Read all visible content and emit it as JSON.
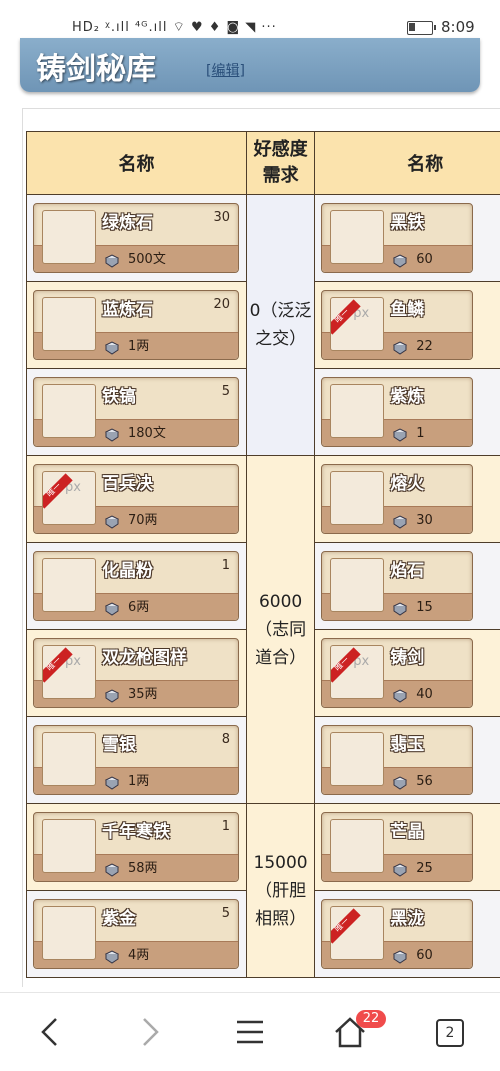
{
  "statusbar": {
    "left_icons": "HD₂ ᵡ.ıll ⁴ᴳ.ıll ⌔ ♥ ♦ ◙ ◥ ···",
    "time": "8:09"
  },
  "header": {
    "title": "铸剑秘库",
    "edit_label": "编辑",
    "bracket_open": "[",
    "bracket_close": "]"
  },
  "table": {
    "headers": {
      "name": "名称",
      "favor": "好感度需求",
      "name2": "名称"
    },
    "favor_groups": [
      "0（泛泛之交）",
      "6000（志同道合）",
      "15000（肝胆相照）"
    ],
    "left_items": [
      {
        "name": "绿炼石",
        "qty": "30",
        "price": "500文"
      },
      {
        "name": "蓝炼石",
        "qty": "20",
        "price": "1两"
      },
      {
        "name": "铁镐",
        "qty": "5",
        "price": "180文"
      },
      {
        "name": "百兵决",
        "qty": "",
        "price": "70两",
        "px": "px",
        "ribbon": "唯一"
      },
      {
        "name": "化晶粉",
        "qty": "1",
        "price": "6两"
      },
      {
        "name": "双龙枪图样",
        "qty": "",
        "price": "35两",
        "px": "px",
        "ribbon": "唯一"
      },
      {
        "name": "雪银",
        "qty": "8",
        "price": "1两"
      },
      {
        "name": "千年寒铁",
        "qty": "1",
        "price": "58两"
      },
      {
        "name": "紫金",
        "qty": "5",
        "price": "4两"
      }
    ],
    "right_items": [
      {
        "name": "黑铁",
        "price": "60"
      },
      {
        "name": "鱼鳞",
        "price": "22",
        "px": "px",
        "ribbon": "唯一"
      },
      {
        "name": "紫炼",
        "price": "1"
      },
      {
        "name": "熔火",
        "price": "30"
      },
      {
        "name": "焰石",
        "price": "15"
      },
      {
        "name": "铸剑",
        "price": "40",
        "px": "px",
        "ribbon": "唯一"
      },
      {
        "name": "翡玉",
        "price": "56"
      },
      {
        "name": "芒晶",
        "price": "25"
      },
      {
        "name": "黑泷",
        "price": "60",
        "ribbon": "唯一"
      }
    ]
  },
  "bottomnav": {
    "tab_count": "2",
    "badge": "22"
  },
  "colors": {
    "header": "#7a9fbf",
    "table_header": "#fbe3ad",
    "border": "#4e3d2a"
  }
}
